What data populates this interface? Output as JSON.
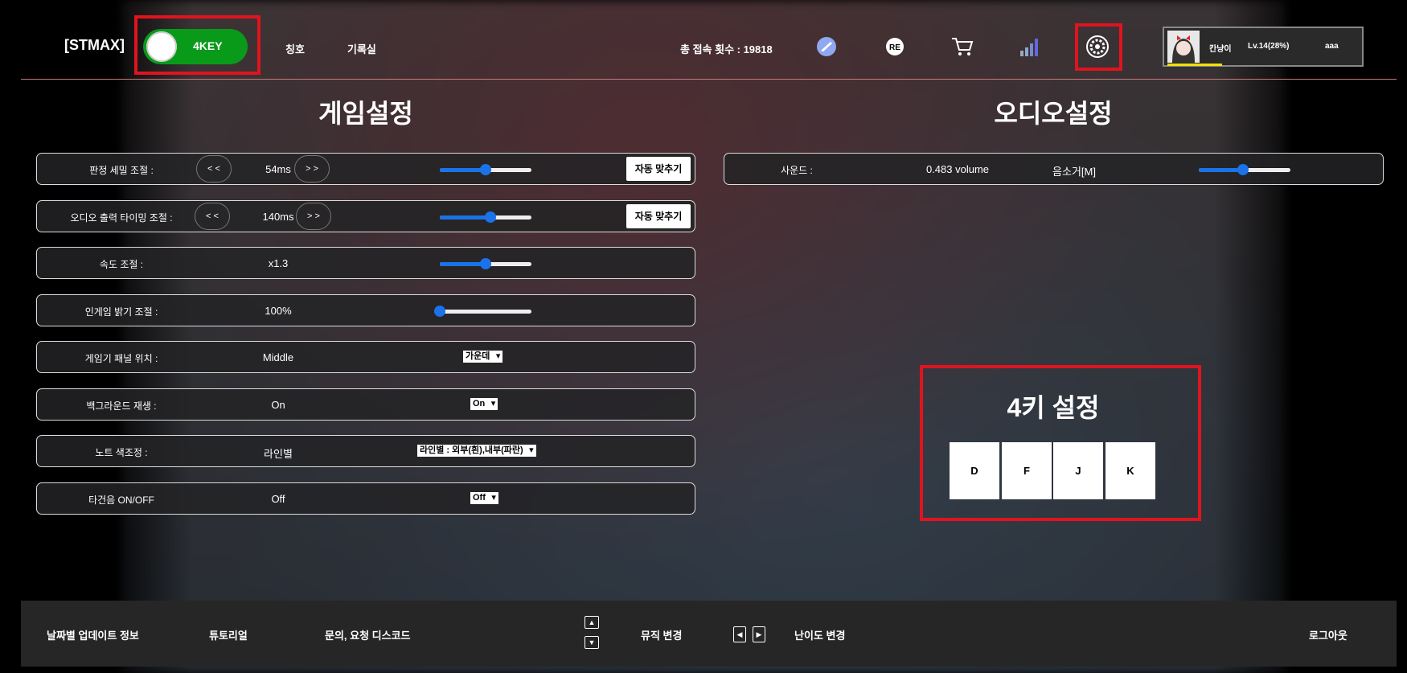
{
  "header": {
    "logo": "[STMAX]",
    "mode_toggle": "4KEY",
    "nav": [
      "칭호",
      "기록실"
    ],
    "visits": "총 접속 횟수 : 19818",
    "profile": {
      "name": "칸냥이",
      "level": "Lv.14(28%)",
      "id": "aaa"
    }
  },
  "game_settings": {
    "title": "게임설정",
    "rows": [
      {
        "label": "판정 세밀 조절 :",
        "value": "54ms",
        "dec": "< <",
        "inc": "> >",
        "slider": 0.5,
        "auto": "자동 맞추기"
      },
      {
        "label": "오디오 출력 타이밍 조절 :",
        "value": "140ms",
        "dec": "< <",
        "inc": "> >",
        "slider": 0.55,
        "auto": "자동 맞추기"
      },
      {
        "label": "속도 조절 :",
        "value": "x1.3",
        "slider": 0.5
      },
      {
        "label": "인게임 밝기 조절 :",
        "value": "100%",
        "slider": 0.0
      },
      {
        "label": "게임기 패널 위치 :",
        "value": "Middle",
        "select": "가운데"
      },
      {
        "label": "백그라운드 재생 :",
        "value": "On",
        "select": "On"
      },
      {
        "label": "노트 색조정 :",
        "value": "라인별",
        "select": "라인별 : 외부(흰),내부(파란)"
      },
      {
        "label": "타건음 ON/OFF",
        "value": "Off",
        "select": "Off"
      }
    ]
  },
  "audio_settings": {
    "title": "오디오설정",
    "label": "사운드 :",
    "value": "0.483 volume",
    "mute": "음소거[M]",
    "slider": 0.48
  },
  "key_settings": {
    "title": "4키 설정",
    "keys": [
      "D",
      "F",
      "J",
      "K"
    ]
  },
  "footer": {
    "update_info": "날짜별 업데이트 정보",
    "tutorial": "튜토리얼",
    "discord": "문의, 요청 디스코드",
    "music_change": "뮤직 변경",
    "difficulty_change": "난이도 변경",
    "logout": "로그아웃"
  },
  "colors": {
    "highlight": "#e0141e",
    "toggle_on": "#0a9a1a",
    "slider": "#1a73e8"
  }
}
